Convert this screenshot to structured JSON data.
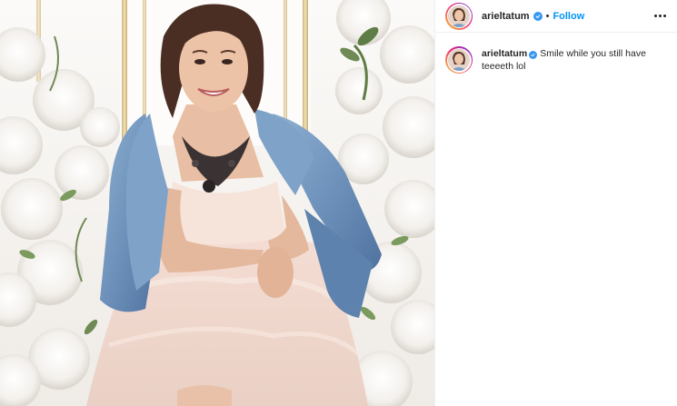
{
  "post": {
    "image_alt": "",
    "header": {
      "username": "arieltatum",
      "separator": "•",
      "follow_label": "Follow",
      "verified": true
    },
    "caption": {
      "username": "arieltatum",
      "text": "Smile while you still have teeeeth lol",
      "verified": true
    }
  },
  "colors": {
    "accent": "#0095f6",
    "verified": "#3897f0",
    "text": "#262626",
    "divider": "#efefef"
  },
  "icons": {
    "verified": "verified-badge-icon",
    "more": "more-options-icon"
  }
}
